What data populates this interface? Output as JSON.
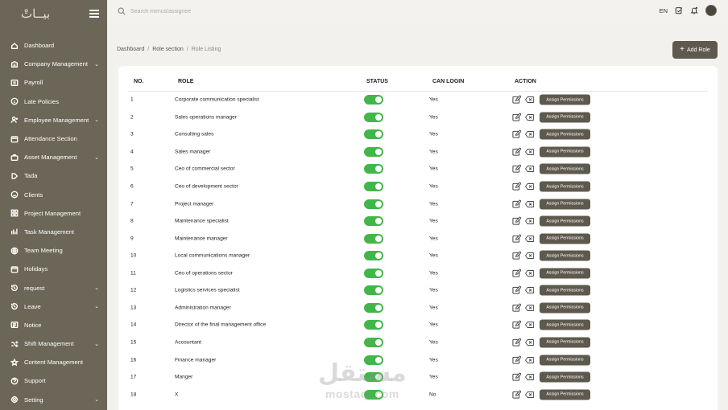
{
  "sidebar": {
    "logo": "بيــاتْ",
    "items": [
      {
        "label": "Dashboard",
        "icon": "home-icon",
        "chevron": false
      },
      {
        "label": "Company Management",
        "icon": "building-icon",
        "chevron": true
      },
      {
        "label": "Payroll",
        "icon": "payroll-icon",
        "chevron": false
      },
      {
        "label": "Late Policies",
        "icon": "info-icon",
        "chevron": false
      },
      {
        "label": "Employee Management",
        "icon": "add-user-icon",
        "chevron": true
      },
      {
        "label": "Attendance Section",
        "icon": "calendar-icon",
        "chevron": false
      },
      {
        "label": "Asset Management",
        "icon": "briefcase-icon",
        "chevron": true
      },
      {
        "label": "Tada",
        "icon": "tag-icon",
        "chevron": false
      },
      {
        "label": "Clients",
        "icon": "smile-icon",
        "chevron": false
      },
      {
        "label": "Project Management",
        "icon": "grid-icon",
        "chevron": false
      },
      {
        "label": "Task Management",
        "icon": "bar-chart-icon",
        "chevron": false
      },
      {
        "label": "Team Meeting",
        "icon": "globe-icon",
        "chevron": false
      },
      {
        "label": "Holidays",
        "icon": "calendar-icon",
        "chevron": false
      },
      {
        "label": "request",
        "icon": "history-icon",
        "chevron": true
      },
      {
        "label": "Leave",
        "icon": "history-icon",
        "chevron": true
      },
      {
        "label": "Notice",
        "icon": "notice-icon",
        "chevron": false
      },
      {
        "label": "Shift Management",
        "icon": "shuffle-icon",
        "chevron": true
      },
      {
        "label": "Content Management",
        "icon": "star-icon",
        "chevron": false
      },
      {
        "label": "Support",
        "icon": "support-icon",
        "chevron": false
      },
      {
        "label": "Setting",
        "icon": "gear-icon",
        "chevron": true
      }
    ],
    "chevron_glyph": "⌄"
  },
  "topbar": {
    "search_placeholder": "Search menus/assignee",
    "language": "EN"
  },
  "breadcrumb": {
    "items": [
      "Dashboard",
      "Role section",
      "Role Listing"
    ],
    "separator": "/"
  },
  "add_role_label": "Add Role",
  "table": {
    "headers": {
      "no": "NO.",
      "role": "ROLE",
      "status": "STATUS",
      "can_login": "CAN LOGIN",
      "action": "ACTION"
    },
    "assign_label": "Assign Permissions",
    "rows": [
      {
        "no": "1",
        "role": "Corporate communication specialist",
        "can_login": "Yes",
        "status": "on"
      },
      {
        "no": "2",
        "role": "Sales operations manager",
        "can_login": "Yes",
        "status": "on"
      },
      {
        "no": "3",
        "role": "Consulting sales",
        "can_login": "Yes",
        "status": "on"
      },
      {
        "no": "4",
        "role": "Sales manager",
        "can_login": "Yes",
        "status": "on"
      },
      {
        "no": "5",
        "role": "Ceo of commercial sector",
        "can_login": "Yes",
        "status": "on"
      },
      {
        "no": "6",
        "role": "Ceo of development sector",
        "can_login": "Yes",
        "status": "on"
      },
      {
        "no": "7",
        "role": "Project manager",
        "can_login": "Yes",
        "status": "on"
      },
      {
        "no": "8",
        "role": "Maintenance specialist",
        "can_login": "Yes",
        "status": "on"
      },
      {
        "no": "9",
        "role": "Maintenance manager",
        "can_login": "Yes",
        "status": "on"
      },
      {
        "no": "10",
        "role": "Local communications manager",
        "can_login": "Yes",
        "status": "on"
      },
      {
        "no": "11",
        "role": "Ceo of operations sector",
        "can_login": "Yes",
        "status": "on"
      },
      {
        "no": "12",
        "role": "Logistics services specialist",
        "can_login": "Yes",
        "status": "on"
      },
      {
        "no": "13",
        "role": "Administration manager",
        "can_login": "Yes",
        "status": "on"
      },
      {
        "no": "14",
        "role": "Director of the final management office",
        "can_login": "Yes",
        "status": "on"
      },
      {
        "no": "15",
        "role": "Accountant",
        "can_login": "Yes",
        "status": "on"
      },
      {
        "no": "16",
        "role": "Finance manager",
        "can_login": "Yes",
        "status": "on"
      },
      {
        "no": "17",
        "role": "Manger",
        "can_login": "Yes",
        "status": "on"
      },
      {
        "no": "18",
        "role": "X",
        "can_login": "No",
        "status": "on"
      }
    ]
  },
  "watermark": {
    "arabic": "مستقل",
    "latin": "mostaql.com"
  },
  "colors": {
    "sidebar": "#6b6657",
    "accent": "#5e594d",
    "toggle_on": "#43b649",
    "background": "#f3f1ee"
  }
}
